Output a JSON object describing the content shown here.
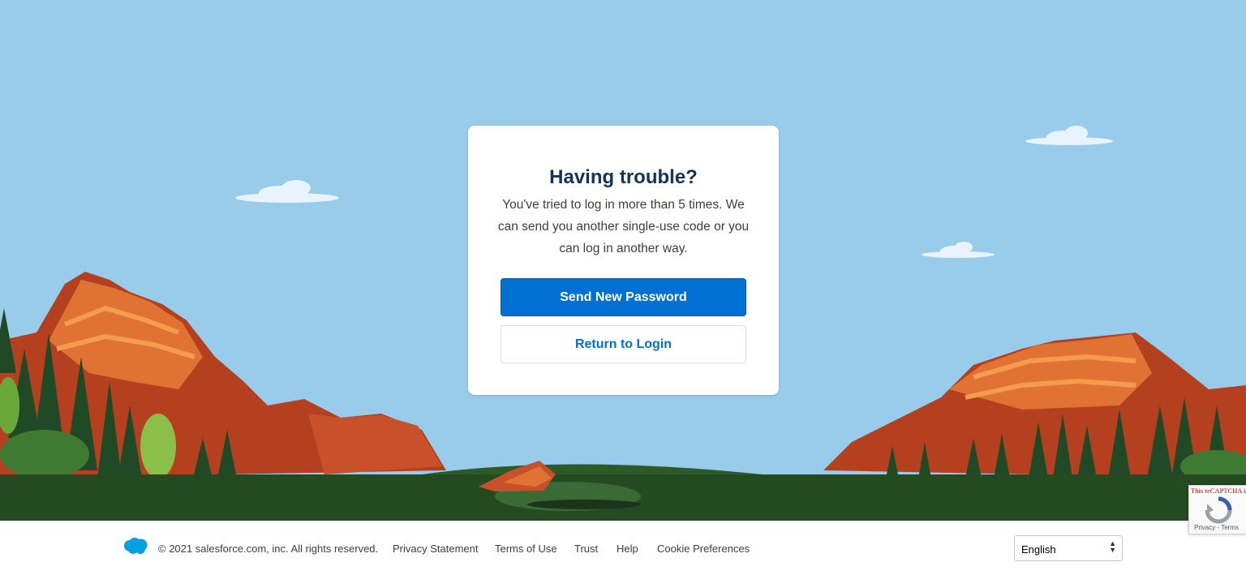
{
  "card": {
    "title": "Having trouble?",
    "message": "You've tried to log in more than 5 times. We can send you another single-use code or you can log in another way.",
    "primary_button": "Send New Password",
    "secondary_button": "Return to Login"
  },
  "footer": {
    "logo_icon": "salesforce-cloud-icon",
    "copyright": "© 2021 salesforce.com, inc. All rights reserved.",
    "links": [
      "Privacy Statement",
      "Terms of Use",
      "Trust",
      "Help",
      "Cookie Preferences"
    ],
    "language": "English"
  },
  "recaptcha": {
    "warning": "This reCAPTCHA is for testing purposes only. Please report to the site admin if you are seeing this.",
    "terms": "Privacy - Terms"
  },
  "colors": {
    "sky": "#99cbea",
    "primary": "#0070d2",
    "title": "#16325c",
    "ground": "#244a22",
    "rock": "#d9602a"
  }
}
